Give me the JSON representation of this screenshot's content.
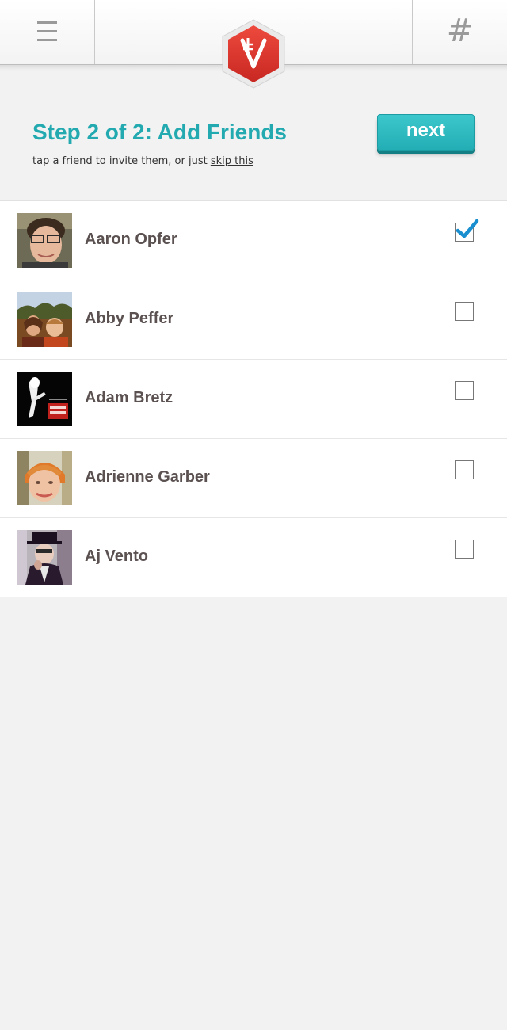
{
  "topbar": {
    "menu_icon": "hamburger-icon",
    "logo_icon": "app-logo-hexagon",
    "hash_glyph": "#"
  },
  "header": {
    "title": "Step 2 of 2: Add Friends",
    "subtitle_prefix": "tap a friend to invite them, or just ",
    "skip_label": "skip this",
    "next_label": "next"
  },
  "friends": [
    {
      "name": "Aaron Opfer",
      "checked": true
    },
    {
      "name": "Abby Peffer",
      "checked": false
    },
    {
      "name": "Adam Bretz",
      "checked": false
    },
    {
      "name": "Adrienne Garber",
      "checked": false
    },
    {
      "name": "Aj Vento",
      "checked": false
    }
  ],
  "colors": {
    "accent": "#23aab0",
    "logo_red": "#d9322b",
    "name_text": "#5b5151",
    "check": "#1a8fd0"
  }
}
